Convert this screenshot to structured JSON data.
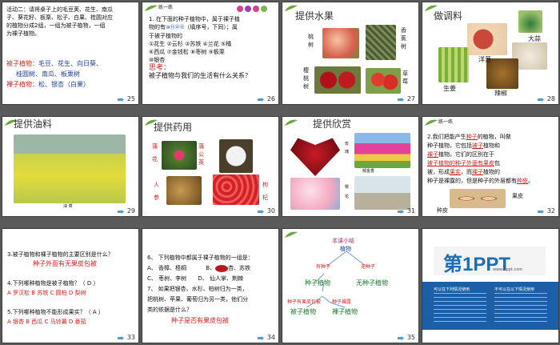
{
  "slides": [
    {
      "num": "25",
      "line1": "活动二：请将桌子上的毛豆荚、花生、南瓜",
      "line2": "子、葵花籽、板栗、松子、白果、桂圆对应",
      "line3": "的植物分成2组，一组为被子植物，一组",
      "line4": "为裸子植物。",
      "line5": "被子植物：",
      "line6": "毛豆、花生、向日葵、",
      "line7": "桂圆树、南瓜、板栗树",
      "line8": "裸子植物：",
      "line9": "松、银杏（白果）"
    },
    {
      "num": "26",
      "lianyilian": "练一练",
      "q1": "1. 在下面的种子植物中，属于裸子植",
      "q2": "物的有",
      "q2b": "（填序号，下同）；属",
      "q3": "于被子植物的",
      "q4": "①花生  ②云杉  ③苏铁  ④兰花  ⑤橘",
      "q5": "⑥西瓜  ⑦金钱松  ⑧枣树  ⑨板栗",
      "q6": "⑩银杏",
      "think": "思考：",
      "q7": "被子植物与我们的生活有什么关系？"
    },
    {
      "num": "27",
      "title": "提供水果",
      "a": "桃树",
      "b": "香蕉树",
      "c": "樱桃树",
      "d": "草莓"
    },
    {
      "num": "28",
      "title": "做调料",
      "a": "大蒜",
      "b": "洋葱",
      "c": "生姜",
      "d": "辣椒"
    },
    {
      "num": "29",
      "title": "提供油料",
      "caption": "油 菜"
    },
    {
      "num": "30",
      "title": "提供药用",
      "a": "蒲",
      "b": "花",
      "c": "蒲公英",
      "d": "人",
      "e": "参",
      "f": "枸",
      "g": "杞"
    },
    {
      "num": "31",
      "title": "提供欣赏",
      "a": "玫",
      "b": "瑰",
      "c": "郁金香",
      "d": "樱",
      "e": "花"
    },
    {
      "num": "32",
      "lianyilian": "练一练",
      "l1": "2.我们把能产生",
      "w1": "种子",
      "l1b": "的植物，叫做",
      "l2": "种子植物，它包括",
      "w2": "被子",
      "l2b": "植物和",
      "w3": "裸子",
      "l3": "植物。它们的区别在于",
      "w4": "被子植物的种子外面有",
      "w5": "果皮",
      "l4": "包",
      "l5": "被，形成",
      "w6": "果实",
      "l5b": "，而",
      "w7": "裸子",
      "l5c": "植物的",
      "l6": "种子是裸露的，但是种子的外层都有",
      "w8": "种皮",
      "l6b": "。",
      "pi": "果皮",
      "zp": "种皮"
    },
    {
      "num": "33",
      "q1": "3.被子植物和裸子植物的主要区别是什么？",
      "a1": "种子外面有无果皮包被",
      "q2": "4.下列哪种植物是被子植物？（ D  ）",
      "o2": "A 罗汉松  B 苏铁  C 圆柏  D 梨树",
      "q3": "5.下列哪种植物不能形成果实？（ A ）",
      "o3": "A 银杏  B 西瓜  C 马铃薯  D 番茄"
    },
    {
      "num": "34",
      "q6": "6、 下列植物中都属于裸子植物的一组是：",
      "oA": "A、 香樟、梧桐",
      "oB": "B、",
      "oB2": "杏、苏铁",
      "oC": "C、 枣树、李树",
      "oD": "D、 仙人掌、荆棘",
      "q7a": "7、 如果把银杏、水杉、柏树归为一类，",
      "q7b": "把桃树、苹果、葡萄归为另一类，他们分",
      "q7c": "类的依据是什么？",
      "ans": "种子是否有果皮包被"
    },
    {
      "num": "35",
      "heading": "本课小结",
      "root": "植物",
      "l": "有种子",
      "r": "无种子",
      "mid": "种子植物",
      "right": "无种子植物",
      "ll": "种子有果皮包被",
      "rr": "种子裸露",
      "bz": "被子植物",
      "lz": "裸子植物"
    },
    {
      "num": "",
      "brand": "第1PPT",
      "url": "www.1ppt.com",
      "b1": "可以在下列情况使用",
      "b2": "不可以在以下情况使用"
    }
  ]
}
